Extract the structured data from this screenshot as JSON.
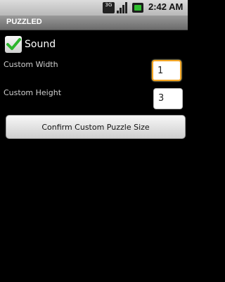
{
  "status_bar": {
    "network_label": "3G",
    "time": "2:42 AM",
    "icons": [
      "network-3g-icon",
      "signal-icon",
      "battery-icon"
    ]
  },
  "app": {
    "title": "PUZZLED"
  },
  "sound": {
    "label": "Sound",
    "checked": true
  },
  "width": {
    "label": "Custom Width",
    "value": "1"
  },
  "height": {
    "label": "Custom Height",
    "value": "3"
  },
  "confirm": {
    "label": "Confirm Custom Puzzle Size"
  },
  "colors": {
    "background": "#000000",
    "focus_border": "#f5a623",
    "battery_green": "#2fbf2f"
  }
}
